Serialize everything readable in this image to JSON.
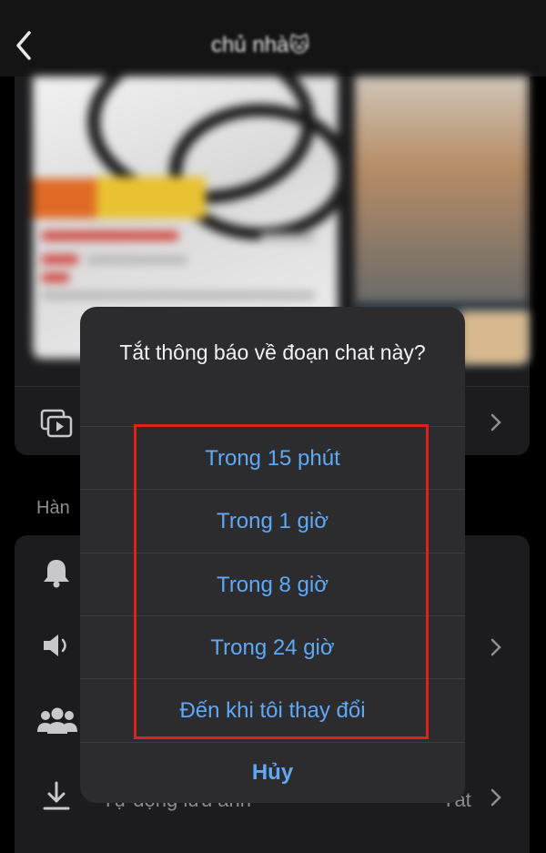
{
  "header": {
    "title": "chủ nhà",
    "title_emoji": "🐱"
  },
  "settings": {
    "section_label": "Hàn",
    "bottom_row_label": "Tự động lưu ảnh",
    "bottom_row_value": "Tắt"
  },
  "dialog": {
    "title": "Tắt thông báo về đoạn chat này?",
    "options": [
      "Trong 15 phút",
      "Trong 1 giờ",
      "Trong 8 giờ",
      "Trong 24 giờ",
      "Đến khi tôi thay đổi"
    ],
    "cancel_label": "Hủy"
  },
  "colors": {
    "background": "#000000",
    "card": "#1c1c1e",
    "sheet": "#2c2c2e",
    "accent": "#5fa8f5",
    "highlight": "#e0201b"
  }
}
